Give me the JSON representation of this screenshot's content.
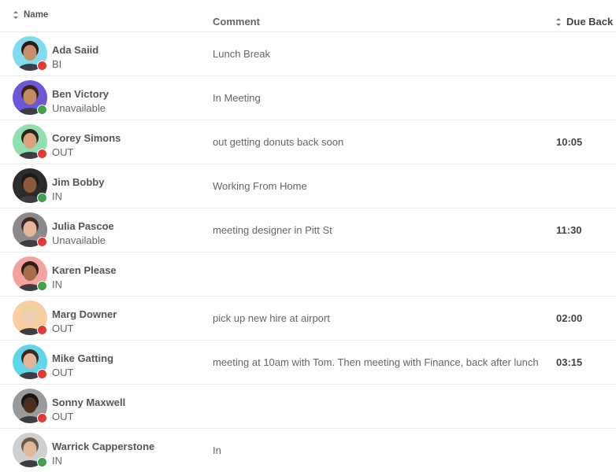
{
  "header": {
    "name": "Name",
    "comment": "Comment",
    "due_back": "Due Back"
  },
  "colors": {
    "status_red": "#e53935",
    "status_green": "#43a047"
  },
  "rows": [
    {
      "name": "Ada Saiid",
      "status": "BI",
      "comment": "Lunch Break",
      "due": "",
      "dot": "red",
      "avatar_bg": "#7fdcef",
      "skin": "#c98d6a",
      "hair": "#2b1a14"
    },
    {
      "name": "Ben Victory",
      "status": "Unavailable",
      "comment": "In Meeting",
      "due": "",
      "dot": "green",
      "avatar_bg": "#6b57d8",
      "skin": "#c48a62",
      "hair": "#3a2416"
    },
    {
      "name": "Corey Simons",
      "status": "OUT",
      "comment": "out getting donuts back soon",
      "due": "10:05",
      "dot": "red",
      "avatar_bg": "#8fe0b0",
      "skin": "#d9a27a",
      "hair": "#2a2420"
    },
    {
      "name": "Jim Bobby",
      "status": "IN",
      "comment": "Working From Home",
      "due": "",
      "dot": "green",
      "avatar_bg": "#2c2c2c",
      "skin": "#8a5a3c",
      "hair": "#1b1b1b"
    },
    {
      "name": "Julia Pascoe",
      "status": "Unavailable",
      "comment": "meeting designer in Pitt St",
      "due": "11:30",
      "dot": "red",
      "avatar_bg": "#8a8a8a",
      "skin": "#e4b79a",
      "hair": "#3b2a24"
    },
    {
      "name": "Karen Please",
      "status": "IN",
      "comment": "",
      "due": "",
      "dot": "green",
      "avatar_bg": "#f4a1a1",
      "skin": "#a86c4a",
      "hair": "#2d1d14"
    },
    {
      "name": "Marg Downer",
      "status": "OUT",
      "comment": "pick up new hire at airport",
      "due": "02:00",
      "dot": "red",
      "avatar_bg": "#f7cfa0",
      "skin": "#f0cdb4",
      "hair": "#e8d49c"
    },
    {
      "name": "Mike Gatting",
      "status": "OUT",
      "comment": "meeting at 10am with Tom. Then meeting with Finance, back after lunch",
      "due": "03:15",
      "dot": "red",
      "avatar_bg": "#5fd7ea",
      "skin": "#e3b598",
      "hair": "#3a2a22"
    },
    {
      "name": "Sonny Maxwell",
      "status": "OUT",
      "comment": "",
      "due": "",
      "dot": "red",
      "avatar_bg": "#9a9a9a",
      "skin": "#4a2e20",
      "hair": "#1a1410"
    },
    {
      "name": "Warrick Capperstone",
      "status": "IN",
      "comment": "In",
      "due": "",
      "dot": "green",
      "avatar_bg": "#cfcfcf",
      "skin": "#e0b89c",
      "hair": "#6a5a4a"
    }
  ]
}
